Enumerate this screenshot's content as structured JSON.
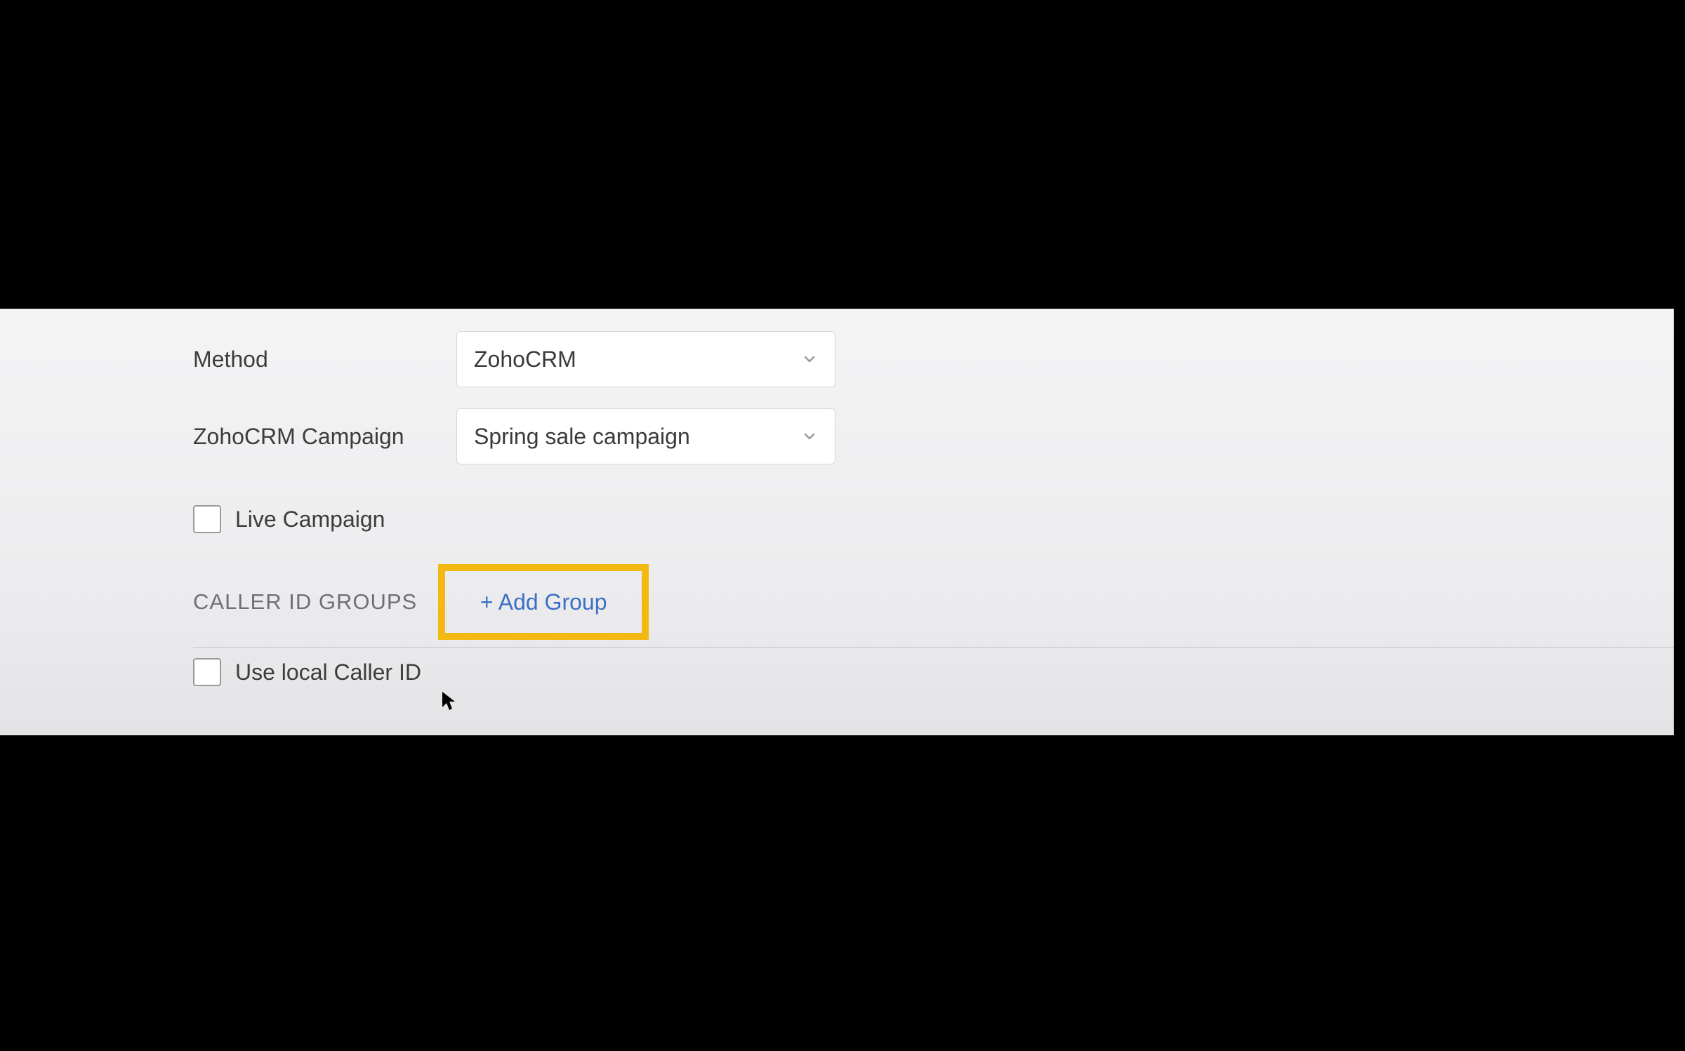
{
  "form": {
    "method": {
      "label": "Method",
      "selected": "ZohoCRM"
    },
    "campaign": {
      "label": "ZohoCRM Campaign",
      "selected": "Spring sale campaign"
    },
    "live_campaign": {
      "label": "Live Campaign",
      "checked": false
    },
    "use_local_caller_id": {
      "label": "Use local Caller ID",
      "checked": false
    }
  },
  "section": {
    "heading": "CALLER ID GROUPS",
    "add_group_label": "+ Add Group"
  },
  "colors": {
    "highlight_border": "#f3b913",
    "link_blue": "#3b70c4",
    "text_primary": "#3c3c3c",
    "text_secondary": "#707072"
  }
}
